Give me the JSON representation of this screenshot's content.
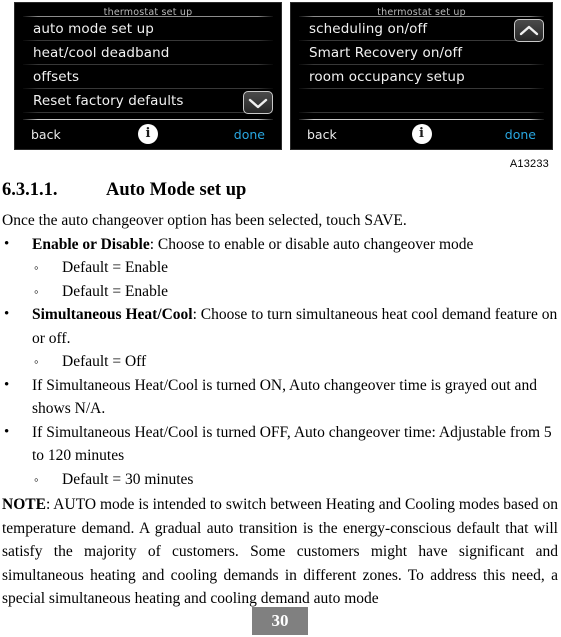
{
  "figure": {
    "caption": "A13233",
    "screens": [
      {
        "name": "left",
        "title": "thermostat set up",
        "items": [
          "auto mode set up",
          "heat/cool deadband",
          "offsets",
          "Reset factory defaults"
        ],
        "empty_rows": 0,
        "scroll_button": "chevron-down",
        "footer": {
          "back": "back",
          "info": "i",
          "done": "done"
        }
      },
      {
        "name": "right",
        "title": "thermostat set up",
        "items": [
          "scheduling on/off",
          "Smart Recovery on/off",
          "room occupancy setup"
        ],
        "empty_rows": 1,
        "scroll_button": "chevron-up",
        "footer": {
          "back": "back",
          "info": "i",
          "done": "done"
        }
      }
    ],
    "colors": {
      "screen_background": "#000000",
      "item_text": "#f2f2f2",
      "title_text": "#b9b9b9",
      "done_accent": "#29a7e1"
    }
  },
  "document": {
    "heading": {
      "number": "6.3.1.1.",
      "title": "Auto Mode set up"
    },
    "intro": "Once the auto changeover option has been selected, touch SAVE.",
    "bullets": [
      {
        "level": 1,
        "bold": "Enable or Disable",
        "rest": ": Choose to enable or disable auto changeover mode"
      },
      {
        "level": 2,
        "bold": "",
        "rest": "Default = Enable"
      },
      {
        "level": 2,
        "bold": "",
        "rest": "Default = Enable"
      },
      {
        "level": 1,
        "bold": "Simultaneous Heat/Cool",
        "rest": ": Choose to turn simultaneous heat cool demand feature on or off."
      },
      {
        "level": 2,
        "bold": "",
        "rest": "Default = Off"
      },
      {
        "level": 1,
        "bold": "",
        "rest": "If Simultaneous Heat/Cool is turned ON, Auto changeover time is grayed out and shows N/A."
      },
      {
        "level": 1,
        "bold": "",
        "rest": "If Simultaneous Heat/Cool is turned OFF, Auto changeover time:  Adjustable from 5 to 120 minutes"
      },
      {
        "level": 2,
        "bold": "",
        "rest": "Default = 30 minutes"
      }
    ],
    "note": {
      "label": "NOTE",
      "text": ":  AUTO mode is intended to switch between Heating and Cooling modes based on temperature demand.  A gradual auto transition is the energy‑conscious default that will satisfy the majority of customers.  Some customers might have significant and simultaneous heating and cooling demands in different zones.  To address this need, a special simultaneous heating and cooling demand auto mode"
    },
    "page_number": "30"
  }
}
